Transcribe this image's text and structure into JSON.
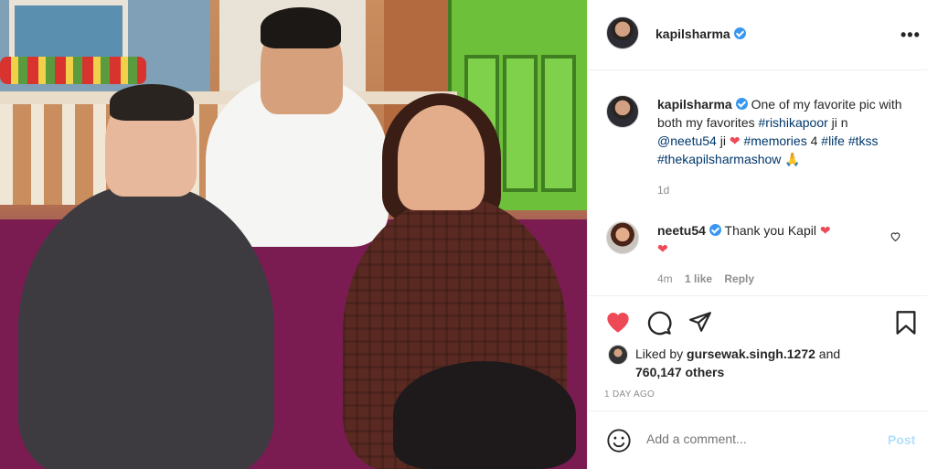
{
  "post": {
    "author": "kapilsharma",
    "more_icon": "more-horizontal-icon"
  },
  "caption": {
    "username": "kapilsharma",
    "text_1": " One of my favorite pic with both my favorites ",
    "tag_1": "#rishikapoor",
    "text_2": " ji n ",
    "tag_2": "@neetu54",
    "text_3": " ji ",
    "tag_3": "#memories",
    "text_4": " 4 ",
    "tag_4": "#life",
    "tag_5": "#tkss",
    "tag_6": "#thekapilsharmashow",
    "emoji_end": "🙏",
    "age": "1d"
  },
  "comment": {
    "username": "neetu54",
    "text": " Thank you Kapil ",
    "age": "4m",
    "likes": "1 like",
    "reply": "Reply"
  },
  "likes": {
    "prefix": "Liked by ",
    "user": "gursewak.singh.1272",
    "middle": " and",
    "count": "760,147 others"
  },
  "date": "1 DAY AGO",
  "comment_box": {
    "placeholder": "Add a comment...",
    "post_label": "Post"
  },
  "colors": {
    "verified": "#3897f0",
    "heart": "#ed4956",
    "tag": "#00376b",
    "post_disabled": "#b2dffc"
  }
}
